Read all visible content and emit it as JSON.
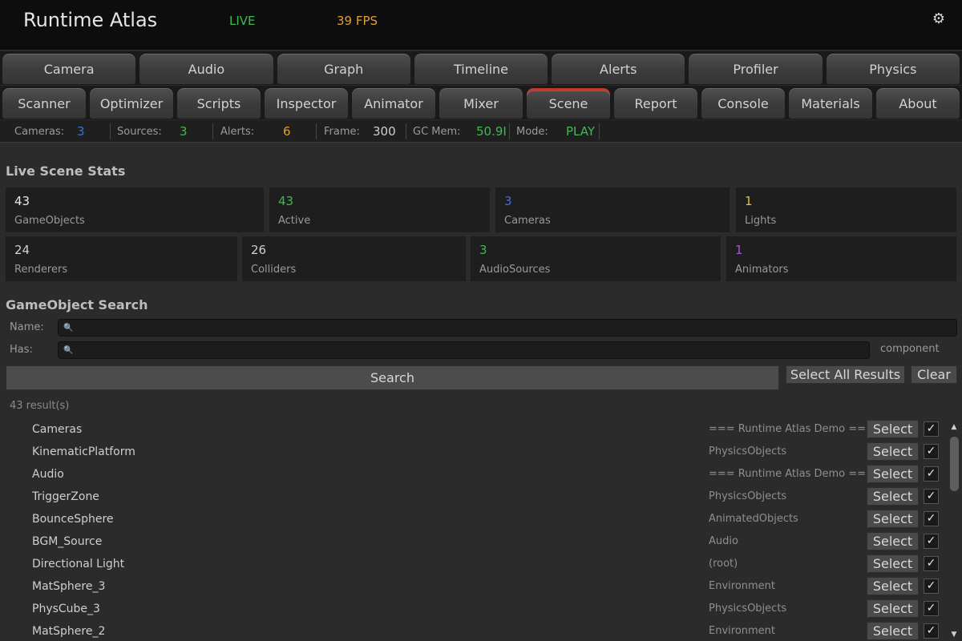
{
  "header": {
    "title": "Runtime Atlas",
    "live": "LIVE",
    "fps": "39 FPS",
    "settings_icon": "gear-icon"
  },
  "colors": {
    "green": "#3dbb4f",
    "orange": "#e0a030",
    "blue": "#3b6fd4",
    "yellow": "#e0c040",
    "purple": "#9b59d6",
    "white": "#e6e6e6"
  },
  "tabs_row1": [
    "Camera",
    "Audio",
    "Graph",
    "Timeline",
    "Alerts",
    "Profiler",
    "Physics"
  ],
  "tabs_row2": [
    "Scanner",
    "Optimizer",
    "Scripts",
    "Inspector",
    "Animator",
    "Mixer",
    "Scene",
    "Report",
    "Console",
    "Materials",
    "About"
  ],
  "active_tab": "Scene",
  "status": {
    "cameras_label": "Cameras:",
    "cameras_val": "3",
    "sources_label": "Sources:",
    "sources_val": "3",
    "alerts_label": "Alerts:",
    "alerts_val": "6",
    "frame_label": "Frame:",
    "frame_val": "300",
    "gcmem_label": "GC Mem:",
    "gcmem_val": "50.9I",
    "mode_label": "Mode:",
    "mode_val": "PLAY"
  },
  "scene_stats": {
    "title": "Live Scene Stats",
    "row1": [
      {
        "value": "43",
        "label": "GameObjects"
      },
      {
        "value": "43",
        "label": "Active"
      },
      {
        "value": "3",
        "label": "Cameras"
      },
      {
        "value": "1",
        "label": "Lights"
      }
    ],
    "row2": [
      {
        "value": "24",
        "label": "Renderers"
      },
      {
        "value": "26",
        "label": "Colliders"
      },
      {
        "value": "3",
        "label": "AudioSources"
      },
      {
        "value": "1",
        "label": "Animators"
      }
    ]
  },
  "search": {
    "title": "GameObject Search",
    "name_label": "Name:",
    "has_label": "Has:",
    "name_value": "",
    "has_value": "",
    "component_hint": "component",
    "search_button": "Search",
    "select_all_button": "Select All Results",
    "clear_button": "Clear",
    "result_count": "43 result(s)"
  },
  "results": [
    {
      "name": "Cameras",
      "parent": "=== Runtime Atlas Demo ===",
      "select": "Select",
      "checked": "✓"
    },
    {
      "name": "KinematicPlatform",
      "parent": "PhysicsObjects",
      "select": "Select",
      "checked": "✓"
    },
    {
      "name": "Audio",
      "parent": "=== Runtime Atlas Demo ===",
      "select": "Select",
      "checked": "✓"
    },
    {
      "name": "TriggerZone",
      "parent": "PhysicsObjects",
      "select": "Select",
      "checked": "✓"
    },
    {
      "name": "BounceSphere",
      "parent": "AnimatedObjects",
      "select": "Select",
      "checked": "✓"
    },
    {
      "name": "BGM_Source",
      "parent": "Audio",
      "select": "Select",
      "checked": "✓"
    },
    {
      "name": "Directional Light",
      "parent": "(root)",
      "select": "Select",
      "checked": "✓"
    },
    {
      "name": "MatSphere_3",
      "parent": "Environment",
      "select": "Select",
      "checked": "✓"
    },
    {
      "name": "PhysCube_3",
      "parent": "PhysicsObjects",
      "select": "Select",
      "checked": "✓"
    },
    {
      "name": "MatSphere_2",
      "parent": "Environment",
      "select": "Select",
      "checked": "✓"
    }
  ]
}
